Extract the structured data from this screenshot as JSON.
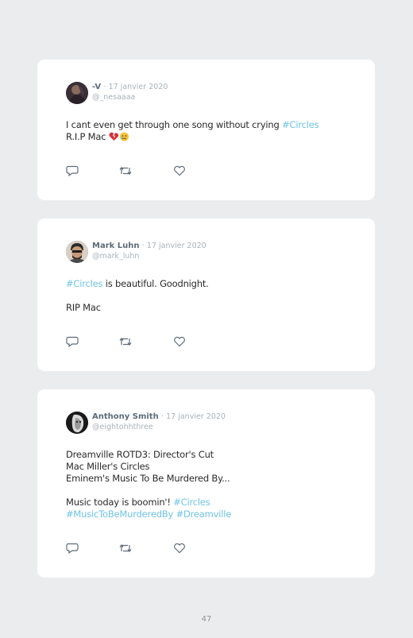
{
  "tweets": [
    {
      "name": "-V",
      "separator": "·",
      "date": "17 janvier 2020",
      "handle": "@_nesaaaa",
      "lines": [
        {
          "text": "I cant even get through one song without crying ",
          "tag": "#Circles"
        },
        {
          "text": "R.I.P Mac "
        }
      ],
      "emoji": [
        "broken-heart",
        "crying-face"
      ]
    },
    {
      "name": "Mark Luhn",
      "separator": "·",
      "date": "17 janvier 2020",
      "handle": "@mark_luhn",
      "lines": [
        {
          "tag": "#Circles",
          "text": " is beautiful. Goodnight."
        },
        {
          "text": ""
        },
        {
          "text": "RIP Mac"
        }
      ]
    },
    {
      "name": "Anthony Smith",
      "separator": "·",
      "date": "17 janvier 2020",
      "handle": "@eightohhthree",
      "lines": [
        {
          "text": "Dreamville ROTD3: Director's Cut"
        },
        {
          "text": "Mac Miller's Circles"
        },
        {
          "text": "Eminem's Music To Be Murdered By..."
        },
        {
          "text": ""
        },
        {
          "text": "Music today is boomin'! ",
          "tag": "#Circles"
        },
        {
          "tag": "#MusicToBeMurderedBy",
          "tag2": "#Dreamville"
        }
      ]
    }
  ],
  "icons": [
    "reply-icon",
    "retweet-icon",
    "like-icon"
  ],
  "colors": {
    "hashtag": "#6fc3e6",
    "name": "#5d6b78",
    "muted": "#a9b1b8",
    "background": "#ebecee"
  },
  "page_number": "47"
}
